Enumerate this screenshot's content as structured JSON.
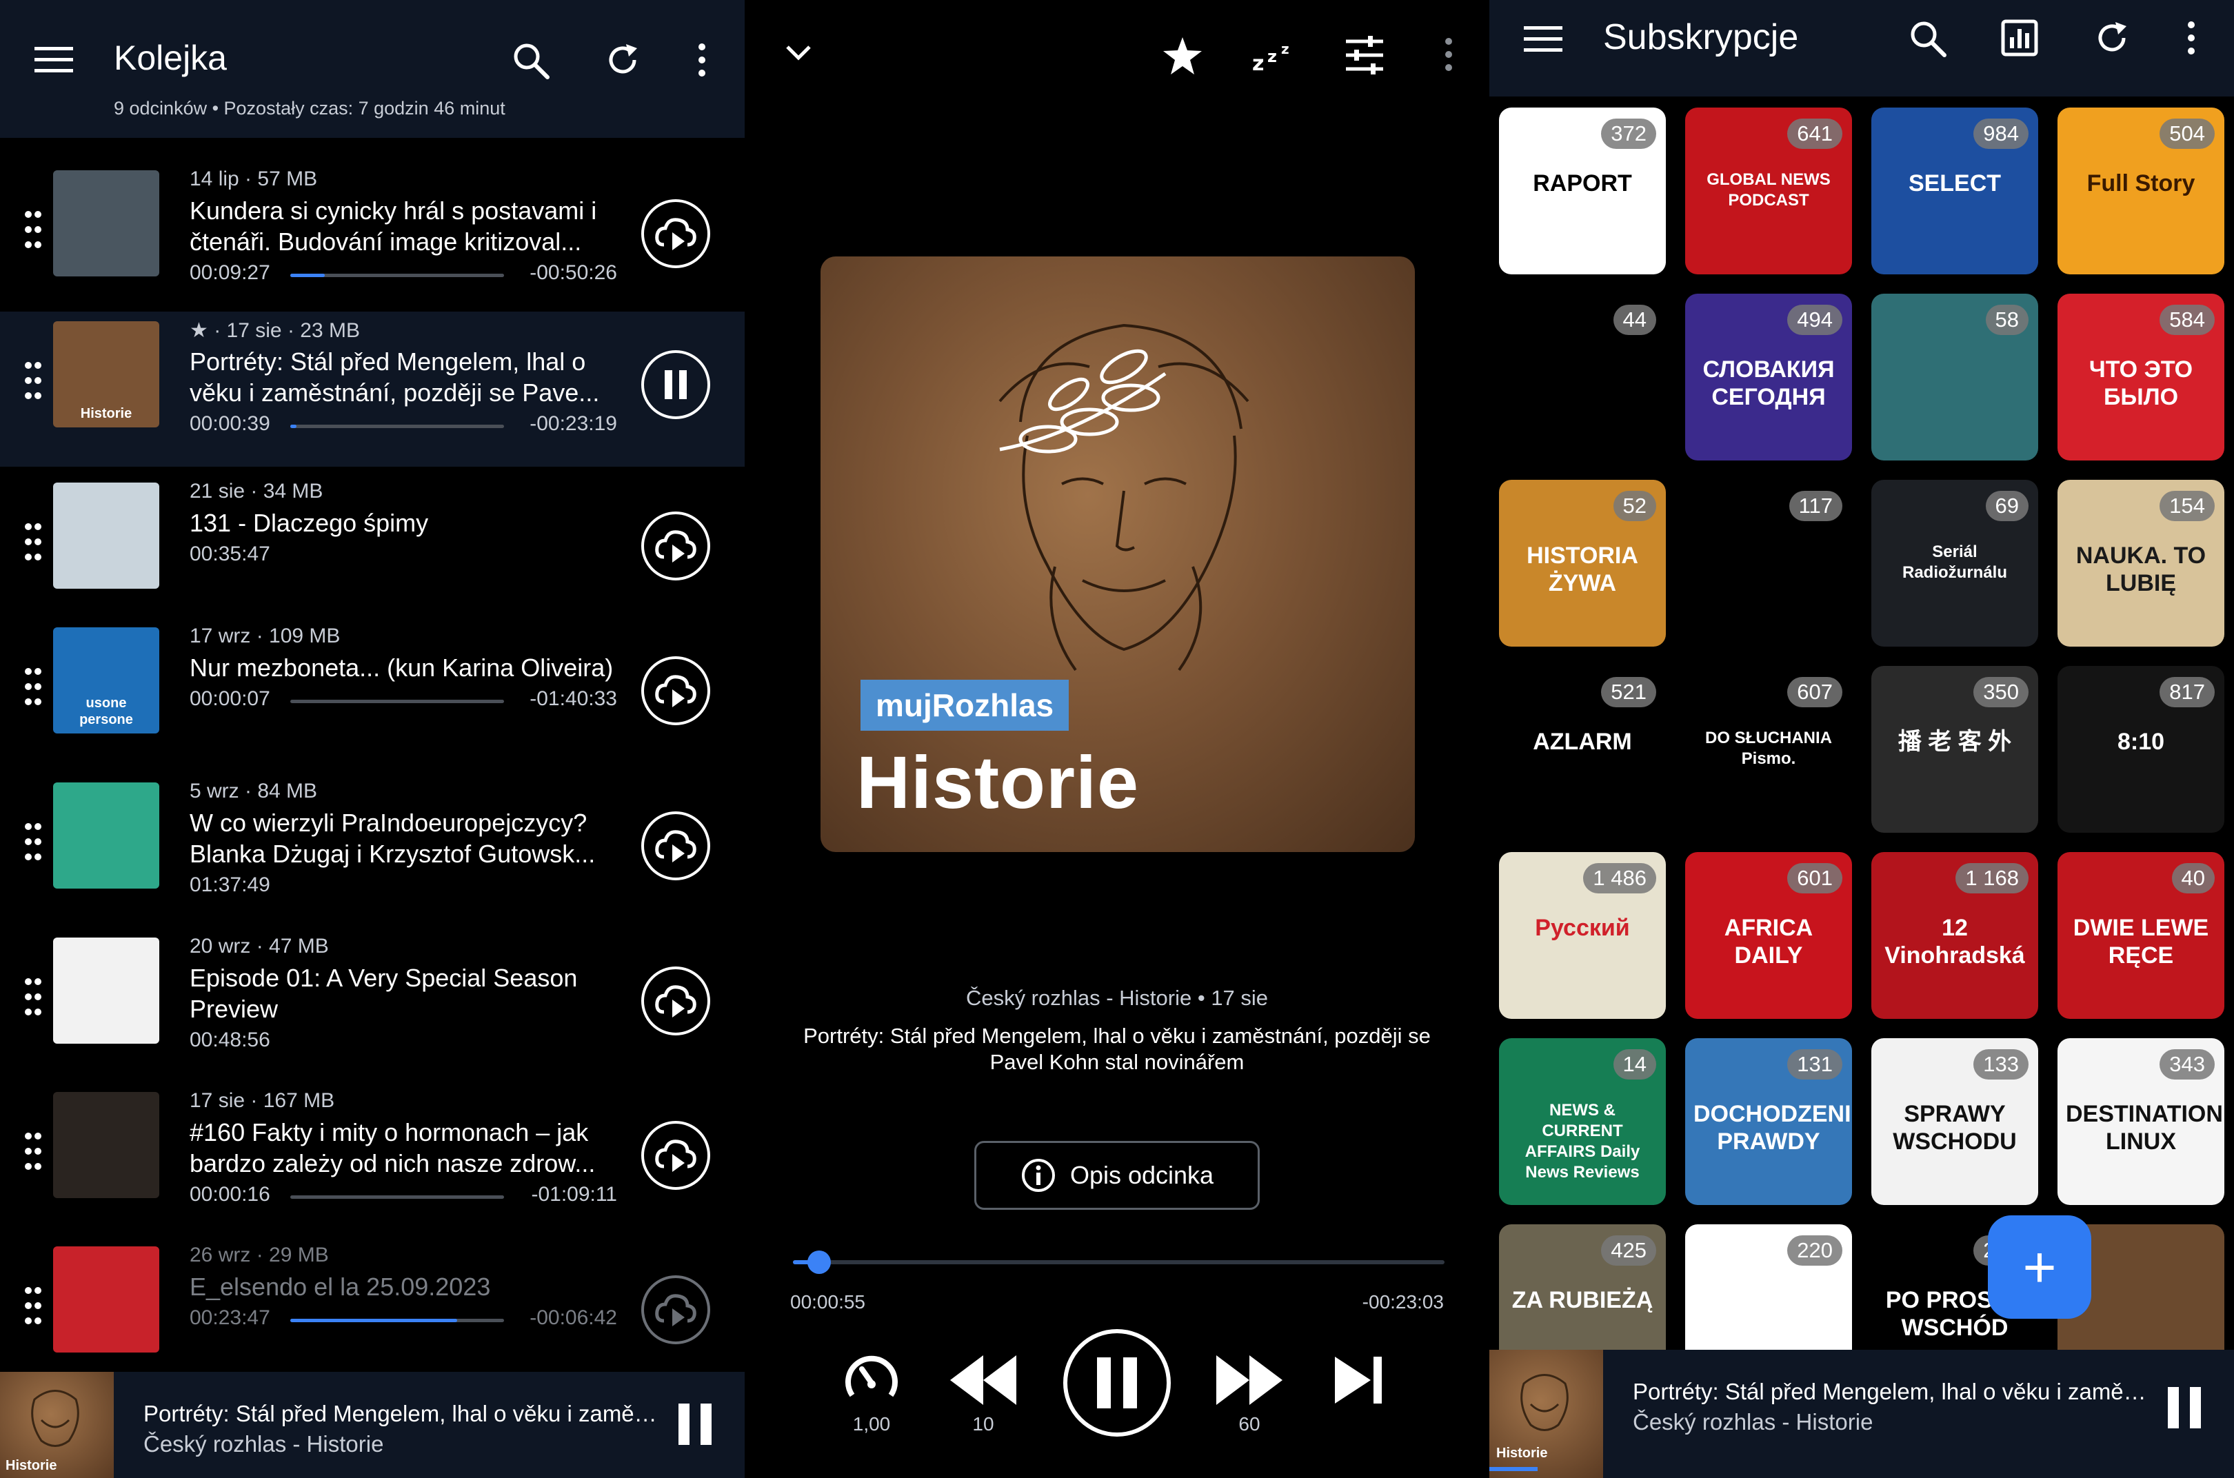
{
  "queue": {
    "title": "Kolejka",
    "summary": "9 odcinków • Pozostały czas: 7 godzin 46 minut",
    "episodes": [
      {
        "meta": "14 lip · 57 MB",
        "title": "Kundera si cynicky hrál s postavami i čtenáři. Budování image kritizoval...",
        "elapsed": "00:09:27",
        "remaining": "-00:50:26",
        "progress": 0.16,
        "action": "download"
      },
      {
        "meta": "★ · 17 sie · 23 MB",
        "title": "Portréty: Stál před Mengelem, lhal o věku i zaměstnání, později se Pave...",
        "elapsed": "00:00:39",
        "remaining": "-00:23:19",
        "progress": 0.03,
        "action": "pause",
        "active": true,
        "art_label": "Historie"
      },
      {
        "meta": "21 sie · 34 MB",
        "title": "131 - Dlaczego śpimy",
        "elapsed": "00:35:47",
        "remaining": "",
        "progress": null,
        "action": "download"
      },
      {
        "meta": "17 wrz · 109 MB",
        "title": "Nur mezboneta... (kun Karina Oliveira)",
        "elapsed": "00:00:07",
        "remaining": "-01:40:33",
        "progress": 0.0,
        "action": "download",
        "art_label": "usone persone"
      },
      {
        "meta": "5 wrz · 84 MB",
        "title": "W co wierzyli PraIndoeuropejczycy? Blanka Dżugaj i Krzysztof Gutowsk...",
        "elapsed": "01:37:49",
        "remaining": "",
        "progress": null,
        "action": "download"
      },
      {
        "meta": "20 wrz · 47 MB",
        "title": "Episode 01: A Very Special Season Preview",
        "elapsed": "00:48:56",
        "remaining": "",
        "progress": null,
        "action": "download"
      },
      {
        "meta": "17 sie · 167 MB",
        "title": "#160 Fakty i mity o hormonach – jak bardzo zależy od nich nasze zdrow...",
        "elapsed": "00:00:16",
        "remaining": "-01:09:11",
        "progress": 0.0,
        "action": "download"
      },
      {
        "meta": "26 wrz · 29 MB",
        "title": "E_elsendo el la 25.09.2023",
        "elapsed": "00:23:47",
        "remaining": "-00:06:42",
        "progress": 0.78,
        "action": "download",
        "dim": true
      }
    ]
  },
  "mini_player": {
    "title": "Portréty: Stál před Mengelem, lhal o věku i zaměstnání, později se Pavel Kohn stal novinářem",
    "podcast": "Český rozhlas - Historie",
    "art_label": "Historie"
  },
  "player": {
    "art_badge": "mujRozhlas",
    "art_title": "Historie",
    "source": "Český rozhlas - Historie  •  17 sie",
    "episode_title": "Portréty: Stál před Mengelem, lhal o věku i zaměstnání, později se Pavel Kohn stal novinářem",
    "description_button": "Opis odcinka",
    "elapsed": "00:00:55",
    "remaining": "-00:23:03",
    "progress": 0.04,
    "speed": "1,00",
    "rewind": "10",
    "forward": "60"
  },
  "subscriptions": {
    "title": "Subskrypcje",
    "add_label": "+",
    "tiles": [
      {
        "count": "372",
        "label": "RAPORT",
        "bg": "#ffffff",
        "fg": "#000000"
      },
      {
        "count": "641",
        "label": "GLOBAL NEWS PODCAST",
        "bg": "#c3151c",
        "fg": "#ffffff"
      },
      {
        "count": "984",
        "label": "SELECT",
        "bg": "#1d4fa0",
        "fg": "#ffffff"
      },
      {
        "count": "504",
        "label": "Full Story",
        "bg": "#f0a01f",
        "fg": "#3a1a00"
      },
      {
        "count": "44",
        "label": "",
        "bg": "#000000",
        "fg": "#ffffff"
      },
      {
        "count": "494",
        "label": "СЛОВАКИЯ СЕГОДНЯ",
        "bg": "#3b2a8c",
        "fg": "#ffffff"
      },
      {
        "count": "58",
        "label": "",
        "bg": "#2f6f75",
        "fg": "#ffffff"
      },
      {
        "count": "584",
        "label": "ЧТО ЭТО БЫЛО",
        "bg": "#d5202a",
        "fg": "#ffffff"
      },
      {
        "count": "52",
        "label": "HISTORIA ŻYWA",
        "bg": "#c9872a",
        "fg": "#ffffff"
      },
      {
        "count": "117",
        "label": "",
        "bg": "#000000",
        "fg": "#ffffff"
      },
      {
        "count": "69",
        "label": "Seriál Radiožurnálu",
        "bg": "#1c1f24",
        "fg": "#ffffff"
      },
      {
        "count": "154",
        "label": "NAUKA. TO LUBIĘ",
        "bg": "#d8c39a",
        "fg": "#1a1a1a"
      },
      {
        "count": "521",
        "label": "AZLARM",
        "bg": "#000000",
        "fg": "#ffffff"
      },
      {
        "count": "607",
        "label": "DO SŁUCHANIA Pismo.",
        "bg": "#000000",
        "fg": "#ffffff"
      },
      {
        "count": "350",
        "label": "播 老 客 外",
        "bg": "#2a2a2a",
        "fg": "#ffffff"
      },
      {
        "count": "817",
        "label": "8:10",
        "bg": "#141414",
        "fg": "#ffffff"
      },
      {
        "count": "1 486",
        "label": "Русский",
        "bg": "#e7e2cf",
        "fg": "#d0202a"
      },
      {
        "count": "601",
        "label": "AFRICA DAILY",
        "bg": "#c8141d",
        "fg": "#ffffff"
      },
      {
        "count": "1 168",
        "label": "12 Vinohradská",
        "bg": "#b3141c",
        "fg": "#ffffff"
      },
      {
        "count": "40",
        "label": "DWIE LEWE RĘCE",
        "bg": "#c0161d",
        "fg": "#ffffff"
      },
      {
        "count": "14",
        "label": "NEWS & CURRENT AFFAIRS Daily News Reviews",
        "bg": "#167e54",
        "fg": "#ffffff"
      },
      {
        "count": "131",
        "label": "DOCHODZENIE PRAWDY",
        "bg": "#3577b8",
        "fg": "#ffffff"
      },
      {
        "count": "133",
        "label": "SPRAWY WSCHODU",
        "bg": "#f2f2f2",
        "fg": "#111111"
      },
      {
        "count": "343",
        "label": "DESTINATION LINUX",
        "bg": "#f5f5f5",
        "fg": "#111111"
      },
      {
        "count": "425",
        "label": "ZA RUBIEŻĄ",
        "bg": "#6b6450",
        "fg": "#ffffff"
      },
      {
        "count": "220",
        "label": "",
        "bg": "#ffffff",
        "fg": "#e05a1e"
      },
      {
        "count": "218",
        "label": "PO PROSTU WSCHÓD",
        "bg": "#000000",
        "fg": "#ffffff"
      },
      {
        "count": "",
        "label": "",
        "bg": "#6b4a2e",
        "fg": "#ffffff"
      }
    ]
  },
  "colors": {
    "accent": "#3b82f6",
    "topbar": "#0e1624",
    "fab": "#2f7bf3"
  }
}
